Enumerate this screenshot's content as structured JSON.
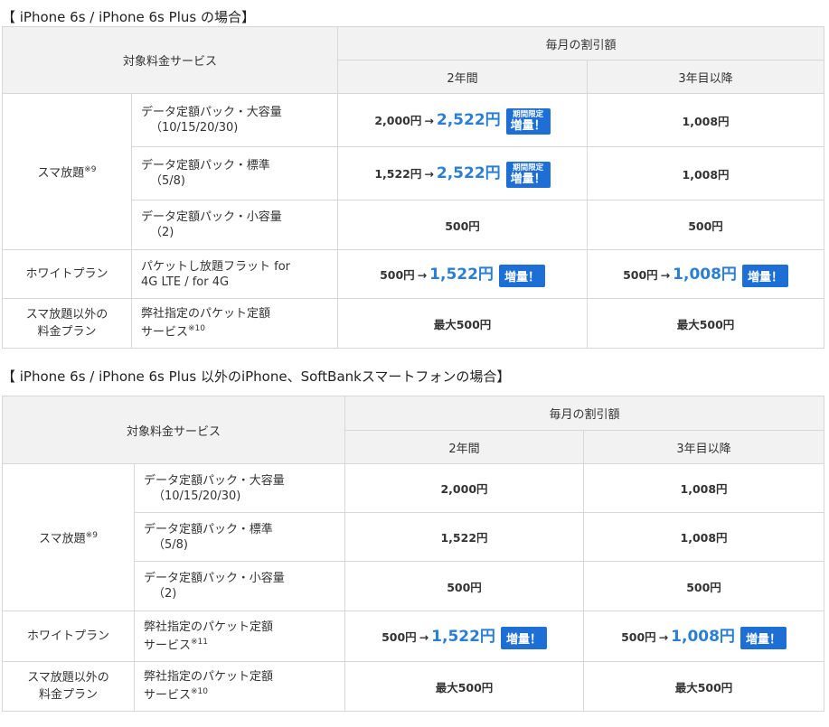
{
  "section1": {
    "title": "【 iPhone 6s / iPhone 6s Plus の場合】",
    "header": {
      "service": "対象料金サービス",
      "discount": "毎月の割引額",
      "y2": "2年間",
      "y3": "3年目以降"
    },
    "sumaho": {
      "label": "スマ放題",
      "note": "※9"
    },
    "rows": [
      {
        "svc1": "データ定額パック・大容量",
        "svc2": "（10/15/20/30)",
        "y2_from": "2,000円",
        "y2_to": "2,522円",
        "y3": "1,008円"
      },
      {
        "svc1": "データ定額パック・標準",
        "svc2": "（5/8)",
        "y2_from": "1,522円",
        "y2_to": "2,522円",
        "y3": "1,008円"
      },
      {
        "svc1": "データ定額パック・小容量",
        "svc2": "（2)",
        "y2": "500円",
        "y3": "500円"
      }
    ],
    "badge_limited": {
      "small": "期間限定",
      "main": "増量！"
    },
    "white": {
      "label": "ホワイトプラン",
      "svc1": "パケットし放題フラット for",
      "svc2": "4G LTE / for 4G",
      "y2_from": "500円",
      "y2_to": "1,522円",
      "y3_from": "500円",
      "y3_to": "1,008円"
    },
    "other": {
      "label1": "スマ放題以外の",
      "label2": "料金プラン",
      "svc1": "弊社指定のパケット定額",
      "svc2": "サービス",
      "note": "※10",
      "y2": "最大500円",
      "y3": "最大500円"
    }
  },
  "section2": {
    "title": "【 iPhone 6s / iPhone 6s Plus 以外のiPhone、SoftBankスマートフォンの場合】",
    "header": {
      "service": "対象料金サービス",
      "discount": "毎月の割引額",
      "y2": "2年間",
      "y3": "3年目以降"
    },
    "sumaho": {
      "label": "スマ放題",
      "note": "※9"
    },
    "rows": [
      {
        "svc1": "データ定額パック・大容量",
        "svc2": "（10/15/20/30)",
        "y2": "2,000円",
        "y3": "1,008円"
      },
      {
        "svc1": "データ定額パック・標準",
        "svc2": "（5/8)",
        "y2": "1,522円",
        "y3": "1,008円"
      },
      {
        "svc1": "データ定額パック・小容量",
        "svc2": "（2)",
        "y2": "500円",
        "y3": "500円"
      }
    ],
    "white": {
      "label": "ホワイトプラン",
      "svc1": "弊社指定のパケット定額",
      "svc2": "サービス",
      "note": "※11",
      "y2_from": "500円",
      "y2_to": "1,522円",
      "y3_from": "500円",
      "y3_to": "1,008円"
    },
    "other": {
      "label1": "スマ放題以外の",
      "label2": "料金プラン",
      "svc1": "弊社指定のパケット定額",
      "svc2": "サービス",
      "note": "※10",
      "y2": "最大500円",
      "y3": "最大500円"
    }
  },
  "badge": "増量！",
  "arrow": "→",
  "colors": {
    "accent": "#2a7fd4",
    "badge": "#1d6fd6",
    "header_bg": "#f2f2f2",
    "border": "#d7d7d7"
  }
}
